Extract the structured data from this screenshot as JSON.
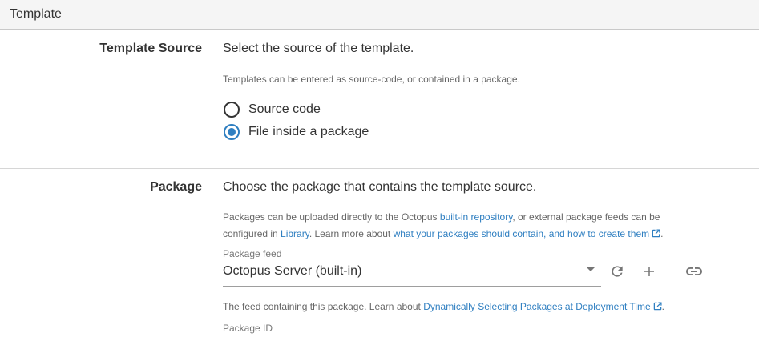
{
  "section": {
    "title": "Template"
  },
  "template_source": {
    "label": "Template Source",
    "description": "Select the source of the template.",
    "help": "Templates can be entered as source-code, or contained in a package.",
    "options": [
      {
        "label": "Source code",
        "checked": false
      },
      {
        "label": "File inside a package",
        "checked": true
      }
    ]
  },
  "package": {
    "label": "Package",
    "description": "Choose the package that contains the template source.",
    "help": {
      "line1_prefix": "Packages can be uploaded directly to the Octopus ",
      "line1_link": "built-in repository",
      "line1_suffix": ", or external package feeds can be",
      "line2_prefix": "configured in ",
      "line2_link1": "Library",
      "line2_middle": ". Learn more about ",
      "line2_link2": "what your packages should contain, and how to create them",
      "line2_suffix": "."
    },
    "feed": {
      "label": "Package feed",
      "value": "Octopus Server (built-in)",
      "help_prefix": "The feed containing this package. Learn about ",
      "help_link": "Dynamically Selecting Packages at Deployment Time",
      "help_suffix": "."
    },
    "package_id": {
      "label": "Package ID"
    }
  },
  "icons": {
    "refresh": "refresh-icon",
    "add": "add-icon",
    "link": "link-icon",
    "external": "external-link-icon"
  },
  "colors": {
    "accent": "#2f7fc1",
    "text": "#333333",
    "help_text": "#666666",
    "header_bg": "#f5f5f5"
  }
}
